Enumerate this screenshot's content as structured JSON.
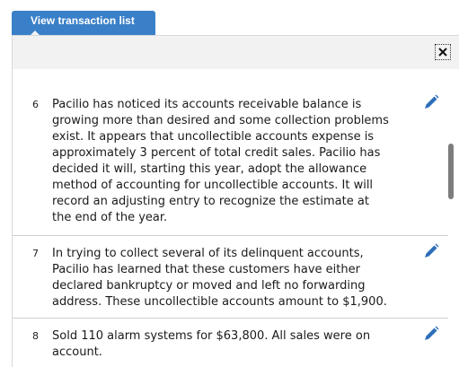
{
  "view_button": {
    "label": "View transaction list"
  },
  "close_button": {
    "icon": "close-icon"
  },
  "edit_icon": {
    "name": "pencil-icon",
    "color": "#2e6fba"
  },
  "transactions": [
    {
      "number": "6",
      "text": "Pacilio has noticed its accounts receivable balance is\ngrowing more than desired and some collection problems\nexist. It appears that uncollectible accounts expense is\napproximately 3 percent of total credit sales. Pacilio has\ndecided it will, starting this year, adopt the allowance\nmethod of accounting for uncollectible accounts. It will\nrecord an adjusting entry to recognize the estimate at\nthe end of the year."
    },
    {
      "number": "7",
      "text": "In trying to collect several of its delinquent accounts,\nPacilio has learned that these customers have either\ndeclared bankruptcy or moved and left no forwarding\naddress. These uncollectible accounts amount to $1,900."
    },
    {
      "number": "8",
      "text": "Sold 110 alarm systems for $63,800. All sales were on\naccount."
    }
  ]
}
